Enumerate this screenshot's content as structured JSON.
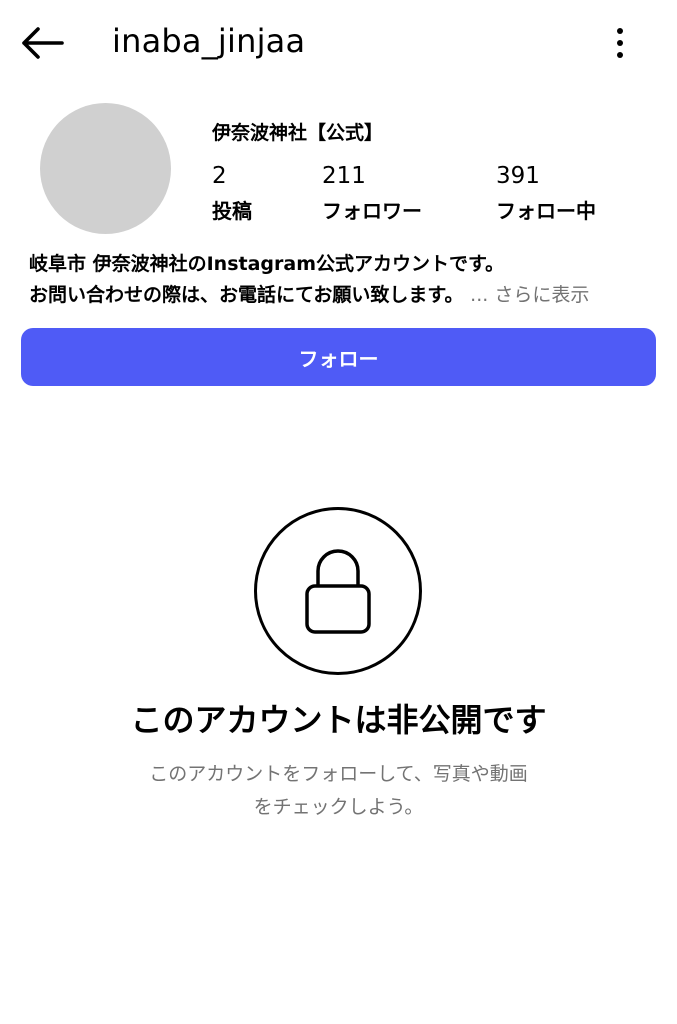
{
  "header": {
    "username": "inaba_jinjaa"
  },
  "profile": {
    "display_name": "伊奈波神社【公式】",
    "stats": {
      "posts": {
        "value": "2",
        "label": "投稿"
      },
      "followers": {
        "value": "211",
        "label": "フォロワー"
      },
      "following": {
        "value": "391",
        "label": "フォロー中"
      }
    },
    "bio": {
      "line1": "岐阜市 伊奈波神社のInstagram公式アカウントです。",
      "line2": "お問い合わせの際は、お電話にてお願い致します。",
      "more": "... さらに表示"
    }
  },
  "actions": {
    "follow_label": "フォロー"
  },
  "private_notice": {
    "title": "このアカウントは非公開です",
    "subtitle_line1": "このアカウントをフォローして、写真や動画",
    "subtitle_line2": "をチェックしよう。"
  },
  "colors": {
    "accent": "#4f5bf6",
    "muted_text": "#737373"
  },
  "icons": {
    "back": "arrow-left-icon",
    "more": "more-vertical-icon",
    "lock": "lock-icon"
  }
}
